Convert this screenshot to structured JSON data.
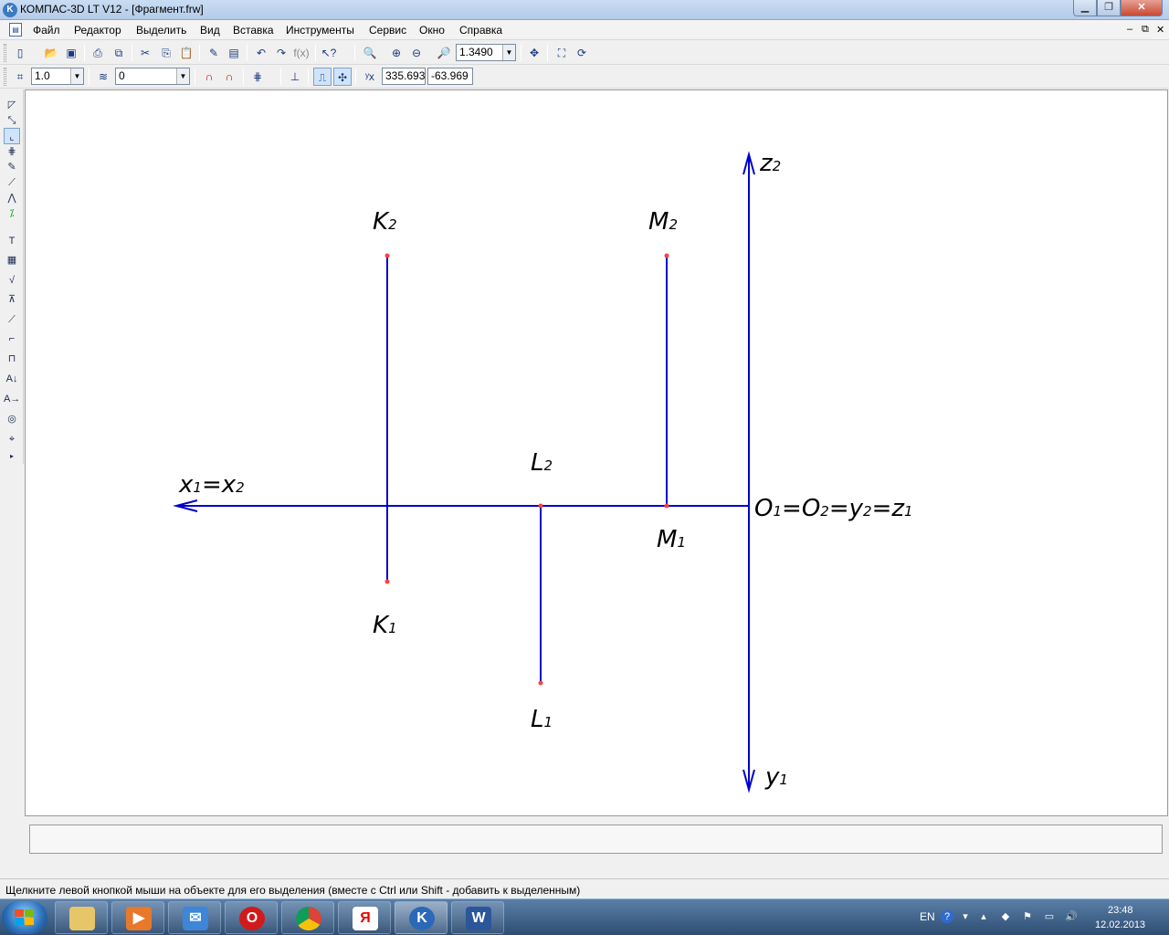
{
  "window": {
    "title": "КОМПАС-3D LT V12 - [Фрагмент.frw]",
    "app_icon": "kompas-logo-icon",
    "controls": {
      "minimize": "▁",
      "maximize": "❐",
      "close": "✕"
    }
  },
  "menu": {
    "items": [
      "Файл",
      "Редактор",
      "Выделить",
      "Вид",
      "Вставка",
      "Инструменты",
      "Сервис",
      "Окно",
      "Справка"
    ],
    "mdi_controls": [
      "‒",
      "⧉",
      "✕"
    ]
  },
  "toolbar_standard": {
    "zoom_value": "1.3490"
  },
  "toolbar_current_state": {
    "step_value": "1.0",
    "layer_value": "0",
    "coord_x": "335.693",
    "coord_y": "-63.969"
  },
  "drawing": {
    "labels": {
      "z2": {
        "main": "z",
        "sub": "2"
      },
      "k2": {
        "main": "K",
        "sub": "2"
      },
      "m2": {
        "main": "M",
        "sub": "2"
      },
      "l2": {
        "main": "L",
        "sub": "2"
      },
      "x_axis": {
        "a": "x",
        "a_sub": "1",
        "eq": "=",
        "b": "x",
        "b_sub": "2"
      },
      "origin": {
        "o1": "O",
        "o1_sub": "1",
        "eq1": "=",
        "o2": "O",
        "o2_sub": "2",
        "eq2": "=",
        "y2": "y",
        "y2_sub": "2",
        "eq3": "=",
        "z1": "z",
        "z1_sub": "1"
      },
      "m1": {
        "main": "M",
        "sub": "1"
      },
      "k1": {
        "main": "K",
        "sub": "1"
      },
      "l1": {
        "main": "L",
        "sub": "1"
      },
      "y1": {
        "main": "y",
        "sub": "1"
      }
    },
    "line_color": "#0000cc",
    "point_color": "#ff4040"
  },
  "status": {
    "hint": "Щелкните левой кнопкой мыши на объекте для его выделения (вместе с Ctrl или Shift - добавить к выделенным)"
  },
  "taskbar": {
    "apps": [
      {
        "name": "explorer-icon",
        "glyph": ""
      },
      {
        "name": "media-player-icon",
        "glyph": "▶"
      },
      {
        "name": "mail-icon",
        "glyph": "✉"
      },
      {
        "name": "opera-icon",
        "glyph": "O"
      },
      {
        "name": "chrome-icon",
        "glyph": ""
      },
      {
        "name": "yandex-icon",
        "glyph": "Я"
      },
      {
        "name": "kompas-icon",
        "glyph": "K"
      },
      {
        "name": "word-icon",
        "glyph": "W"
      }
    ],
    "tray": {
      "lang": "EN",
      "time": "23:48",
      "date": "12.02.2013"
    }
  }
}
